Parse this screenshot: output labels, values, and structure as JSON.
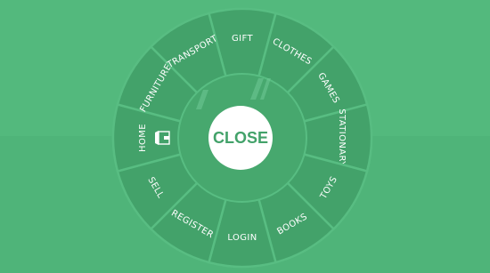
{
  "menu": {
    "close_label": "CLOSE",
    "items": [
      {
        "label": "GIFT",
        "icon": null
      },
      {
        "label": "CLOTHES",
        "icon": null
      },
      {
        "label": "GAMES",
        "icon": null
      },
      {
        "label": "STATIONARY",
        "icon": null
      },
      {
        "label": "TOYS",
        "icon": null
      },
      {
        "label": "BOOKS",
        "icon": null
      },
      {
        "label": "LOGIN",
        "icon": null
      },
      {
        "label": "REGISTER",
        "icon": null
      },
      {
        "label": "SELL",
        "icon": null
      },
      {
        "label": "HOME",
        "icon": "shop-icon"
      },
      {
        "label": "FURNITURE",
        "icon": null
      },
      {
        "label": "TRANSPORT",
        "icon": null
      }
    ]
  },
  "colors": {
    "background": "#52b87c",
    "segment": "#43a26a",
    "segment_border": "#58bd82",
    "close_button": "#ffffff",
    "close_text": "#43a26a"
  }
}
